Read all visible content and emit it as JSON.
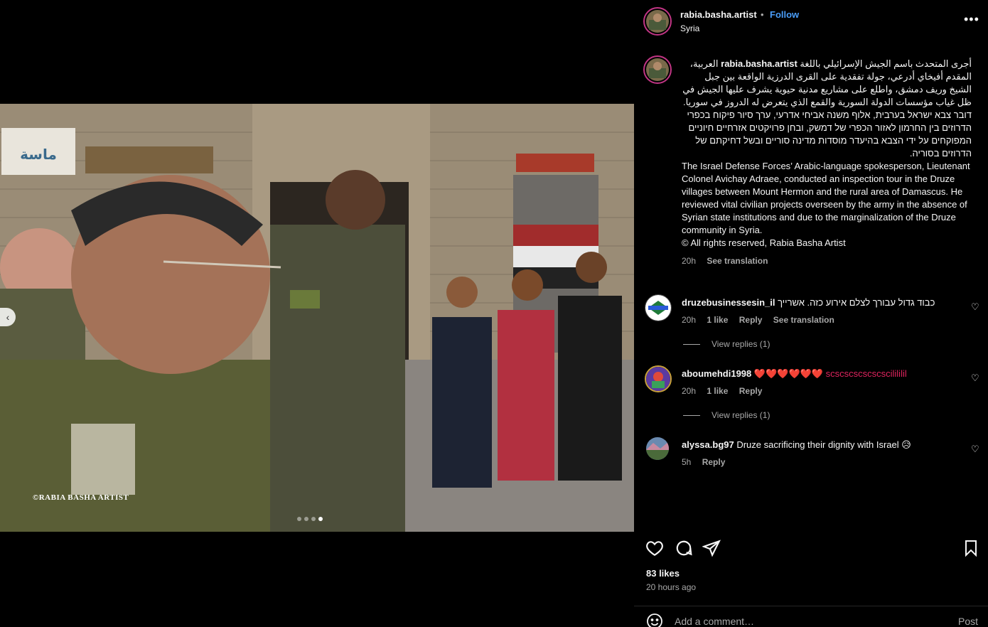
{
  "media": {
    "watermark": "©RABIA BASHA ARTIST",
    "shop_sign_arabic": "ماسة",
    "carousel_dots": 4,
    "active_dot_index": 3
  },
  "header": {
    "username": "rabia.basha.artist",
    "separator": "•",
    "follow_label": "Follow",
    "location": "Syria"
  },
  "caption": {
    "username": "rabia.basha.artist",
    "arabic_first": "أجرى المتحدث باسم الجيش الإسرائيلي باللغة",
    "arabic_rest": "العربية، المقدم أفيخاي أدرعي، جولة تفقدية على القرى الدرزية الواقعة بين جبل الشيخ وريف دمشق، واطلع على مشاريع مدنية حيوية يشرف عليها الجيش في ظل غياب مؤسسات الدولة السورية والقمع الذي يتعرض له الدروز في سوريا.",
    "hebrew": "דובר צבא ישראל בערבית, אלוף משנה אביחי אדרעי, ערך סיור פיקוח בכפרי הדרוזים בין החרמון לאזור הכפרי של דמשק, ובחן פרויקטים אזרחיים חיוניים המפוקחים על ידי הצבא בהיעדר מוסדות מדינה סוריים ובשל דחיקתם של הדרוזים בסוריה.",
    "english": "The Israel Defense Forces’ Arabic-language spokesperson, Lieutenant Colonel Avichay Adraee, conducted an inspection tour in the Druze villages between Mount Hermon and the rural area of Damascus. He reviewed vital civilian projects overseen by the army in the absence of Syrian state institutions and due to the marginalization of the Druze community in Syria.",
    "rights": "© All rights reserved, Rabia Basha Artist",
    "time": "20h",
    "see_translation": "See translation"
  },
  "comments": [
    {
      "username": "druzebusinessesin_il",
      "text": "כבוד גדול עבורך לצלם אירוע כזה. אשרייך",
      "time": "20h",
      "likes": "1 like",
      "reply": "Reply",
      "see_translation": "See translation",
      "view_replies": "View replies (1)"
    },
    {
      "username": "aboumehdi1998",
      "text": "❤️❤️❤️❤️❤️❤️ scscscscscscscilililil",
      "time": "20h",
      "likes": "1 like",
      "reply": "Reply",
      "view_replies": "View replies (1)"
    },
    {
      "username": "alyssa.bg97",
      "text": "Druze sacrificing their dignity with Israel 😥",
      "time": "5h",
      "reply": "Reply"
    }
  ],
  "footer": {
    "likes": "83 likes",
    "time_ago": "20 hours ago",
    "add_comment_placeholder": "Add a comment…",
    "post_label": "Post"
  },
  "icons": {
    "more": "more-options-icon",
    "like": "heart-icon",
    "comment": "comment-icon",
    "share": "share-icon",
    "save": "bookmark-icon",
    "emoji": "emoji-icon"
  },
  "colors": {
    "background": "#000000",
    "text": "#f5f5f5",
    "muted": "#a8a8a8",
    "follow": "#4a9df8",
    "avatar_ring": "#c13584"
  }
}
